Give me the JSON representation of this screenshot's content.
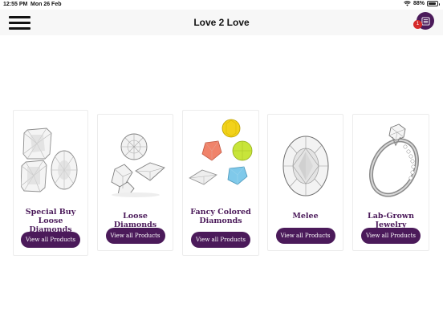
{
  "status_bar": {
    "time": "12:55 PM",
    "date": "Mon 26 Feb",
    "battery": "88%",
    "battery_level": 0.88
  },
  "header": {
    "title": "Love 2 Love",
    "cart_count": "1"
  },
  "categories": [
    {
      "name": "Special Buy Loose Diamonds",
      "button": "View all Products",
      "icon": "cushion-diamonds-image"
    },
    {
      "name": "Loose Diamonds",
      "button": "View all Products",
      "icon": "loose-diamonds-image"
    },
    {
      "name": "Fancy Colored Diamonds",
      "button": "View all Products",
      "icon": "colored-diamonds-image"
    },
    {
      "name": "Melee",
      "button": "View all Products",
      "icon": "oval-diamond-image"
    },
    {
      "name": "Lab-Grown Jewelry",
      "button": "View all Products",
      "icon": "diamond-ring-image"
    }
  ],
  "colors": {
    "brand": "#4b1a5a",
    "badge": "#d62b2b",
    "header_bg": "#f7f7f7"
  }
}
